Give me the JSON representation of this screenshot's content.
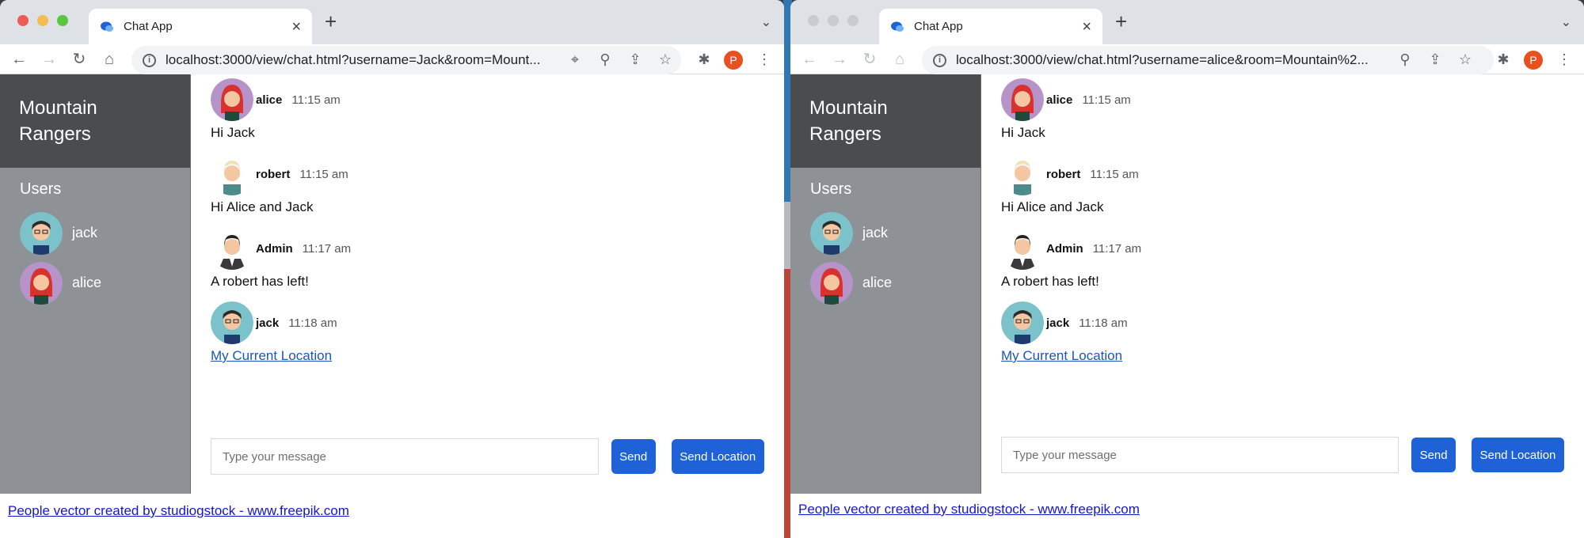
{
  "browser": {
    "tab_title": "Chat App",
    "new_tab": "+",
    "close": "×",
    "left_url": "localhost:3000/view/chat.html?username=Jack&room=Mount...",
    "right_url": "localhost:3000/view/chat.html?username=alice&room=Mountain%2...",
    "profile_initial": "P"
  },
  "room": {
    "name": "Mountain Rangers"
  },
  "sidebar": {
    "users_title": "Users",
    "users": [
      {
        "name": "jack",
        "avatar": "man-teal-avatar"
      },
      {
        "name": "alice",
        "avatar": "woman-purple-avatar"
      }
    ]
  },
  "messages": [
    {
      "user": "alice",
      "time": "11:15 am",
      "text": "Hi Jack"
    },
    {
      "user": "robert",
      "time": "11:15 am",
      "text": "Hi Alice and Jack"
    },
    {
      "user": "Admin",
      "time": "11:17 am",
      "text": "A robert has left!"
    },
    {
      "user": "jack",
      "time": "11:18 am",
      "link": "My Current Location"
    }
  ],
  "compose": {
    "placeholder": "Type your message",
    "send_label": "Send",
    "location_label": "Send Location"
  },
  "footer": {
    "credit": "People vector created by studiogstock - www.freepik.com"
  }
}
